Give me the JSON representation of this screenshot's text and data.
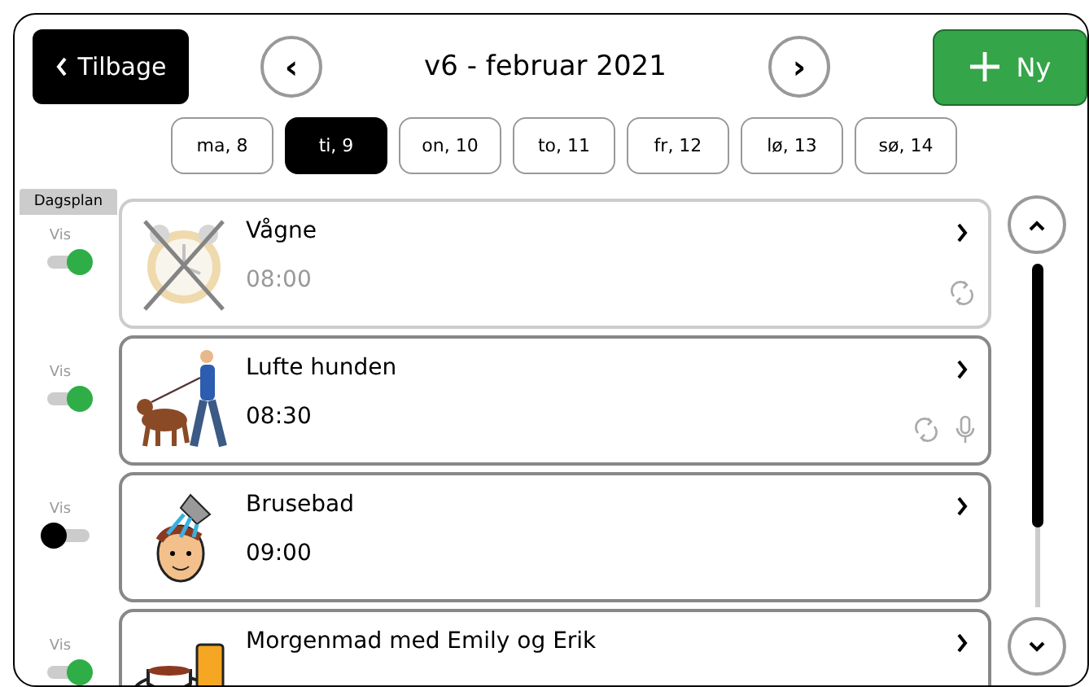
{
  "header": {
    "back_button": "Tilbage",
    "prev_button": "‹",
    "title": "v6 - februar 2021",
    "next_button": "›",
    "new_button": "Ny"
  },
  "days": [
    {
      "label": "ma, 8",
      "selected": false
    },
    {
      "label": "ti, 9",
      "selected": true
    },
    {
      "label": "on, 10",
      "selected": false
    },
    {
      "label": "to, 11",
      "selected": false
    },
    {
      "label": "fr, 12",
      "selected": false
    },
    {
      "label": "lø, 13",
      "selected": false
    },
    {
      "label": "sø, 14",
      "selected": false
    }
  ],
  "section_label": "Dagsplan",
  "activities": [
    {
      "kind": "alarm",
      "toggle_label": "Vis",
      "visible": true,
      "faded": true,
      "title": "Vågne",
      "time": "08:00",
      "repeat": true,
      "audio": false
    },
    {
      "kind": "dogwalk",
      "toggle_label": "Vis",
      "visible": true,
      "faded": false,
      "title": "Lufte hunden",
      "time": "08:30",
      "repeat": true,
      "audio": true
    },
    {
      "kind": "shower",
      "toggle_label": "Vis",
      "visible": false,
      "faded": false,
      "title": "Brusebad",
      "time": "09:00",
      "repeat": false,
      "audio": false
    },
    {
      "kind": "breakfast",
      "toggle_label": "Vis",
      "visible": true,
      "faded": false,
      "title": "Morgenmad med Emily og Erik",
      "repeat": false,
      "audio": false
    }
  ]
}
